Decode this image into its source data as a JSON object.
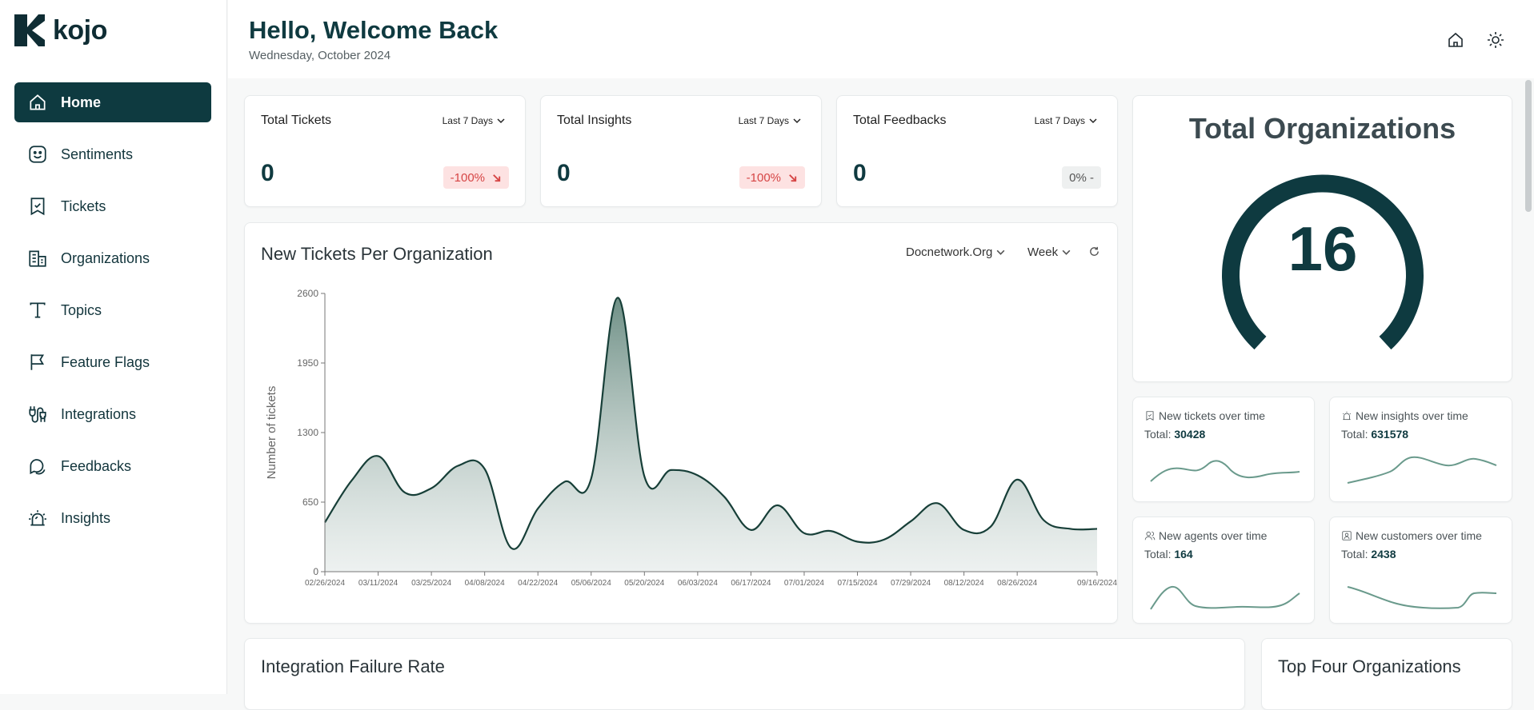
{
  "brand": {
    "name": "kojo"
  },
  "sidebar": {
    "items": [
      {
        "label": "Home",
        "icon": "home-icon",
        "active": true
      },
      {
        "label": "Sentiments",
        "icon": "smile-icon"
      },
      {
        "label": "Tickets",
        "icon": "ticket-icon"
      },
      {
        "label": "Organizations",
        "icon": "building-icon"
      },
      {
        "label": "Topics",
        "icon": "text-icon"
      },
      {
        "label": "Feature Flags",
        "icon": "flag-icon"
      },
      {
        "label": "Integrations",
        "icon": "plug-icon"
      },
      {
        "label": "Feedbacks",
        "icon": "chat-icon"
      },
      {
        "label": "Insights",
        "icon": "alarm-icon"
      }
    ]
  },
  "header": {
    "greeting": "Hello, Welcome Back",
    "date": "Wednesday, October 2024"
  },
  "stats": [
    {
      "title": "Total Tickets",
      "range": "Last 7 Days",
      "value": "0",
      "change": "-100%",
      "trend": "down"
    },
    {
      "title": "Total Insights",
      "range": "Last 7 Days",
      "value": "0",
      "change": "-100%",
      "trend": "down"
    },
    {
      "title": "Total Feedbacks",
      "range": "Last 7 Days",
      "value": "0",
      "change": "0% -",
      "trend": "neutral"
    }
  ],
  "main_chart": {
    "title": "New Tickets Per Organization",
    "org_select": "Docnetwork.Org",
    "period_select": "Week"
  },
  "organizations": {
    "title": "Total Organizations",
    "count": "16"
  },
  "mini_cards": [
    {
      "title": "New tickets over time",
      "icon": "ticket-icon",
      "total_label": "Total:",
      "total": "30428"
    },
    {
      "title": "New insights over time",
      "icon": "alarm-icon",
      "total_label": "Total:",
      "total": "631578"
    },
    {
      "title": "New agents over time",
      "icon": "users-icon",
      "total_label": "Total:",
      "total": "164"
    },
    {
      "title": "New customers over time",
      "icon": "contact-icon",
      "total_label": "Total:",
      "total": "2438"
    }
  ],
  "bottom": {
    "left_title": "Integration Failure Rate",
    "right_title": "Top Four Organizations"
  },
  "colors": {
    "accent": "#0e3a40",
    "negative": "#d64545",
    "negative_bg": "#fde2e2"
  },
  "chart_data": {
    "type": "area",
    "ylabel": "Number of tickets",
    "ylim": [
      0,
      2600
    ],
    "yticks": [
      0,
      650,
      1300,
      1950,
      2600
    ],
    "xticks": [
      "02/26/2024",
      "03/11/2024",
      "03/25/2024",
      "04/08/2024",
      "04/22/2024",
      "05/06/2024",
      "05/20/2024",
      "06/03/2024",
      "06/17/2024",
      "07/01/2024",
      "07/15/2024",
      "07/29/2024",
      "08/12/2024",
      "08/26/2024",
      "09/16/2024"
    ],
    "x": [
      "02/26/2024",
      "03/04/2024",
      "03/11/2024",
      "03/18/2024",
      "03/25/2024",
      "04/01/2024",
      "04/08/2024",
      "04/15/2024",
      "04/22/2024",
      "04/29/2024",
      "05/06/2024",
      "05/13/2024",
      "05/20/2024",
      "05/27/2024",
      "06/03/2024",
      "06/10/2024",
      "06/17/2024",
      "06/24/2024",
      "07/01/2024",
      "07/08/2024",
      "07/15/2024",
      "07/22/2024",
      "07/29/2024",
      "08/05/2024",
      "08/12/2024",
      "08/19/2024",
      "08/26/2024",
      "09/02/2024",
      "09/09/2024",
      "09/16/2024"
    ],
    "values": [
      460,
      850,
      1080,
      740,
      780,
      990,
      960,
      220,
      590,
      840,
      870,
      2560,
      890,
      950,
      900,
      700,
      390,
      620,
      360,
      380,
      280,
      300,
      470,
      640,
      390,
      420,
      860,
      480,
      400,
      400
    ]
  }
}
